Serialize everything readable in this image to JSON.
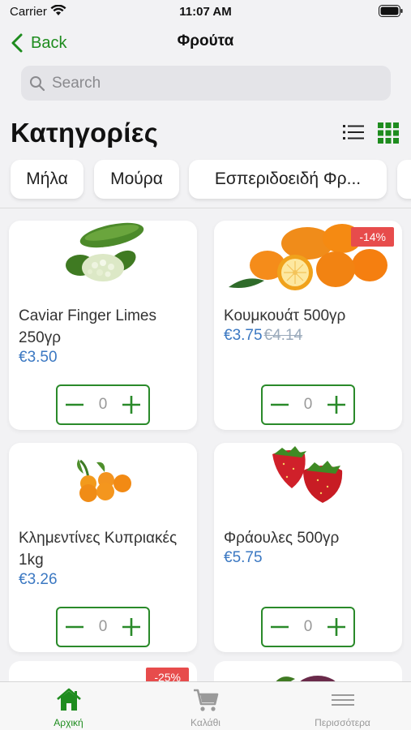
{
  "status": {
    "carrier": "Carrier",
    "time": "11:07 AM"
  },
  "nav": {
    "back_label": "Back",
    "title": "Φρούτα"
  },
  "search": {
    "placeholder": "Search"
  },
  "section_title": "Κατηγορίες",
  "categories": [
    "Μήλα",
    "Μούρα",
    "Εσπεριδοειδή Φρ..."
  ],
  "products": [
    {
      "name": "Caviar Finger Limes 250γρ",
      "price": "€3.50",
      "quantity": "0"
    },
    {
      "name": "Κουμκουάτ 500γρ",
      "price": "€3.75",
      "old_price": "€4.14",
      "badge": "-14%",
      "quantity": "0"
    },
    {
      "name": "Κλημεντίνες Κυπριακές 1kg",
      "price": "€3.26",
      "quantity": "0"
    },
    {
      "name": "Φράουλες 500γρ",
      "price": "€5.75",
      "quantity": "0"
    }
  ],
  "partial_badge": "-25%",
  "tabs": [
    {
      "label": "Αρχική",
      "icon": "home-icon",
      "active": true
    },
    {
      "label": "Καλάθι",
      "icon": "cart-icon"
    },
    {
      "label": "Περισσότερα",
      "icon": "menu-icon"
    }
  ],
  "colors": {
    "accent": "#1e8c1e",
    "price": "#3b78c2",
    "badge": "#e74c4c"
  }
}
